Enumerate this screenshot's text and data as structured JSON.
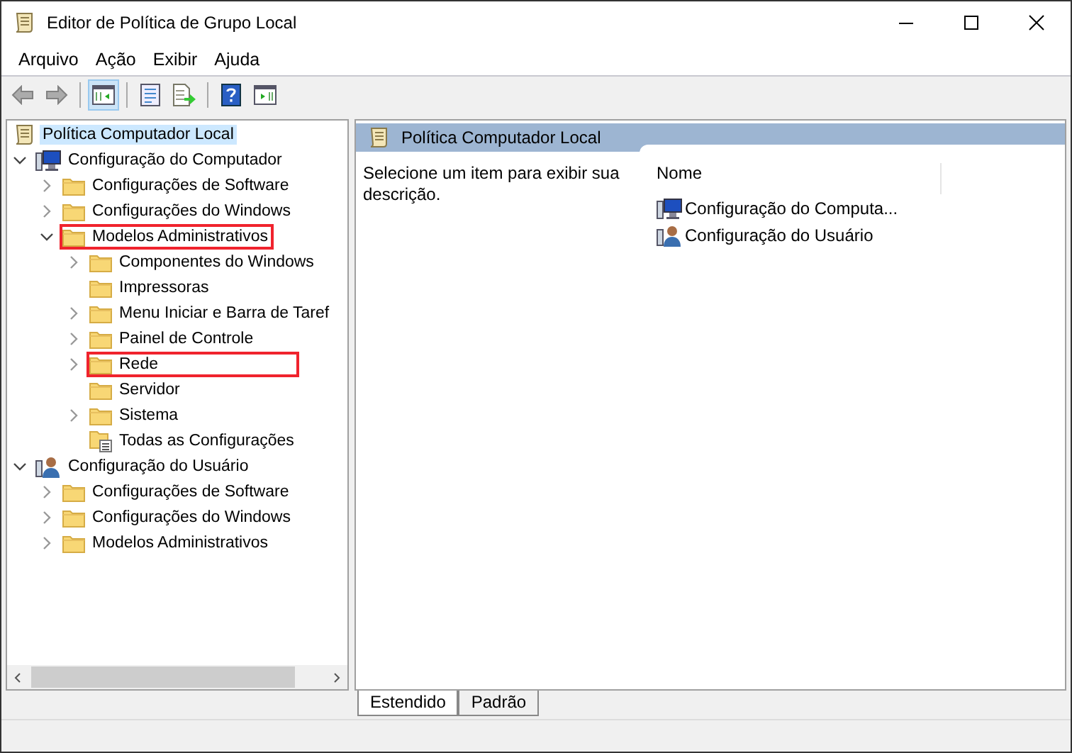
{
  "window": {
    "title": "Editor de Política de Grupo Local"
  },
  "menu": [
    "Arquivo",
    "Ação",
    "Exibir",
    "Ajuda"
  ],
  "toolbar": [
    {
      "kind": "back",
      "pressed": false,
      "disabled": true
    },
    {
      "kind": "forward",
      "pressed": false,
      "disabled": true
    },
    {
      "kind": "tree-toggle",
      "pressed": true,
      "disabled": false
    },
    {
      "kind": "properties",
      "pressed": false,
      "disabled": false
    },
    {
      "kind": "export",
      "pressed": false,
      "disabled": false
    },
    {
      "kind": "help",
      "pressed": false,
      "disabled": false
    },
    {
      "kind": "action-pane",
      "pressed": false,
      "disabled": false
    }
  ],
  "tree": [
    {
      "label": "Política Computador Local",
      "kind": "policy",
      "selected": true,
      "highlighted": false,
      "children": [
        {
          "label": "Configuração do Computador",
          "kind": "computer",
          "expanded": true,
          "selected": false,
          "highlighted": false,
          "children": [
            {
              "label": "Configurações de Software",
              "kind": "folder",
              "expanded": false,
              "selected": false,
              "highlighted": false
            },
            {
              "label": "Configurações do Windows",
              "kind": "folder",
              "expanded": false,
              "selected": false,
              "highlighted": false
            },
            {
              "label": "Modelos Administrativos",
              "kind": "folder",
              "expanded": true,
              "selected": false,
              "highlighted": true,
              "children": [
                {
                  "label": "Componentes do Windows",
                  "kind": "folder",
                  "expanded": false,
                  "selected": false,
                  "highlighted": false
                },
                {
                  "label": "Impressoras",
                  "kind": "folder",
                  "selected": false,
                  "highlighted": false
                },
                {
                  "label": "Menu Iniciar e Barra de Taref",
                  "kind": "folder",
                  "expanded": false,
                  "selected": false,
                  "highlighted": false
                },
                {
                  "label": "Painel de Controle",
                  "kind": "folder",
                  "expanded": false,
                  "selected": false,
                  "highlighted": false
                },
                {
                  "label": "Rede",
                  "kind": "folder",
                  "expanded": false,
                  "selected": false,
                  "highlighted": true
                },
                {
                  "label": "Servidor",
                  "kind": "folder",
                  "selected": false,
                  "highlighted": false
                },
                {
                  "label": "Sistema",
                  "kind": "folder",
                  "expanded": false,
                  "selected": false,
                  "highlighted": false
                },
                {
                  "label": "Todas as Configurações",
                  "kind": "settings",
                  "selected": false,
                  "highlighted": false
                }
              ]
            }
          ]
        },
        {
          "label": "Configuração do Usuário",
          "kind": "user",
          "expanded": true,
          "selected": false,
          "highlighted": false,
          "children": [
            {
              "label": "Configurações de Software",
              "kind": "folder",
              "expanded": false,
              "selected": false,
              "highlighted": false
            },
            {
              "label": "Configurações do Windows",
              "kind": "folder",
              "expanded": false,
              "selected": false,
              "highlighted": false
            },
            {
              "label": "Modelos Administrativos",
              "kind": "folder",
              "expanded": false,
              "selected": false,
              "highlighted": false
            }
          ]
        }
      ]
    }
  ],
  "details": {
    "title": "Política Computador Local",
    "description": "Selecione um item para exibir sua descrição.",
    "column": "Nome",
    "items": [
      {
        "label": "Configuração do Computa...",
        "kind": "computer"
      },
      {
        "label": "Configuração do Usuário",
        "kind": "user"
      }
    ]
  },
  "view_tabs": [
    {
      "label": "Estendido",
      "selected": true
    },
    {
      "label": "Padrão",
      "selected": false
    }
  ]
}
